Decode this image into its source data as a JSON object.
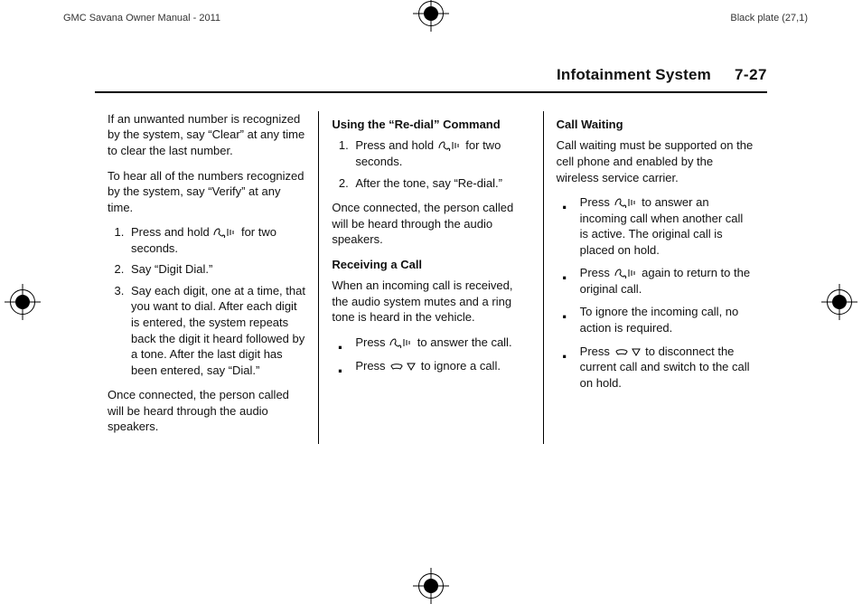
{
  "header": {
    "left_text": "GMC Savana Owner Manual - 2011",
    "right_text": "Black plate (27,1)"
  },
  "section": {
    "title": "Infotainment System",
    "page_number": "7-27"
  },
  "col1": {
    "p1": "If an unwanted number is recognized by the system, say “Clear” at any time to clear the last number.",
    "p2": "To hear all of the numbers recognized by the system, say “Verify” at any time.",
    "ol": [
      {
        "pre": "Press and hold ",
        "post": " for two seconds.",
        "icons": "phone"
      },
      {
        "text": "Say “Digit Dial.”"
      },
      {
        "text": "Say each digit, one at a time, that you want to dial. After each digit is entered, the system repeats back the digit it heard followed by a tone. After the last digit has been entered, say “Dial.”"
      }
    ],
    "p3": "Once connected, the person called will be heard through the audio speakers."
  },
  "col2": {
    "h1": "Using the “Re-dial” Command",
    "ol": [
      {
        "pre": "Press and hold ",
        "post": " for two seconds.",
        "icons": "phone"
      },
      {
        "text": "After the tone, say “Re-dial.”"
      }
    ],
    "p_after_ol": "Once connected, the person called will be heard through the audio speakers.",
    "h2": "Receiving a Call",
    "p_receive": "When an incoming call is received, the audio system mutes and a ring tone is heard in the vehicle.",
    "ul": [
      {
        "pre": "Press ",
        "post": " to answer the call.",
        "icons": "phone"
      },
      {
        "pre": "Press ",
        "post": " to ignore a call.",
        "icons": "hang"
      }
    ]
  },
  "col3": {
    "h1": "Call Waiting",
    "p1": "Call waiting must be supported on the cell phone and enabled by the wireless service carrier.",
    "ul": [
      {
        "pre": "Press ",
        "post": " to answer an incoming call when another call is active. The original call is placed on hold.",
        "icons": "phone"
      },
      {
        "pre": "Press ",
        "post": " again to return to the original call.",
        "icons": "phone"
      },
      {
        "text": "To ignore the incoming call, no action is required."
      },
      {
        "pre": "Press ",
        "post": " to disconnect the current call and switch to the call on hold.",
        "icons": "hang"
      }
    ]
  },
  "icons": {
    "phone_talk": "phone-talk-icon",
    "hangup_down": "hangup-icon"
  }
}
